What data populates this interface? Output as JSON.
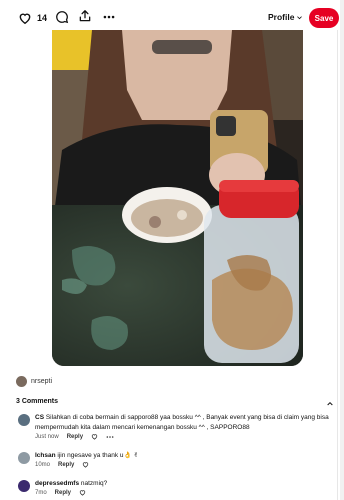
{
  "topbar": {
    "like_count": "14",
    "profile_label": "Profile",
    "save_label": "Save",
    "accent_color": "#e60023"
  },
  "pin": {
    "author_name": "nrsepti"
  },
  "comments": {
    "header": "3 Comments",
    "items": [
      {
        "user": "CS",
        "text": "Silahkan di coba bermain di sapporo88 yaa bossku ^^ , Banyak event yang bisa di claim yang bisa mempermudah kita dalam mencari kemenangan bossku ^^ , SAPPORO88",
        "time": "Just now",
        "reply": "Reply"
      },
      {
        "user": "Ichsan",
        "text": "ijin ngesave ya thank u👌 ✌",
        "time": "10mo",
        "reply": "Reply"
      },
      {
        "user": "depressedmfs",
        "text": "natzmiq?",
        "time": "7mo",
        "reply": "Reply"
      }
    ]
  }
}
